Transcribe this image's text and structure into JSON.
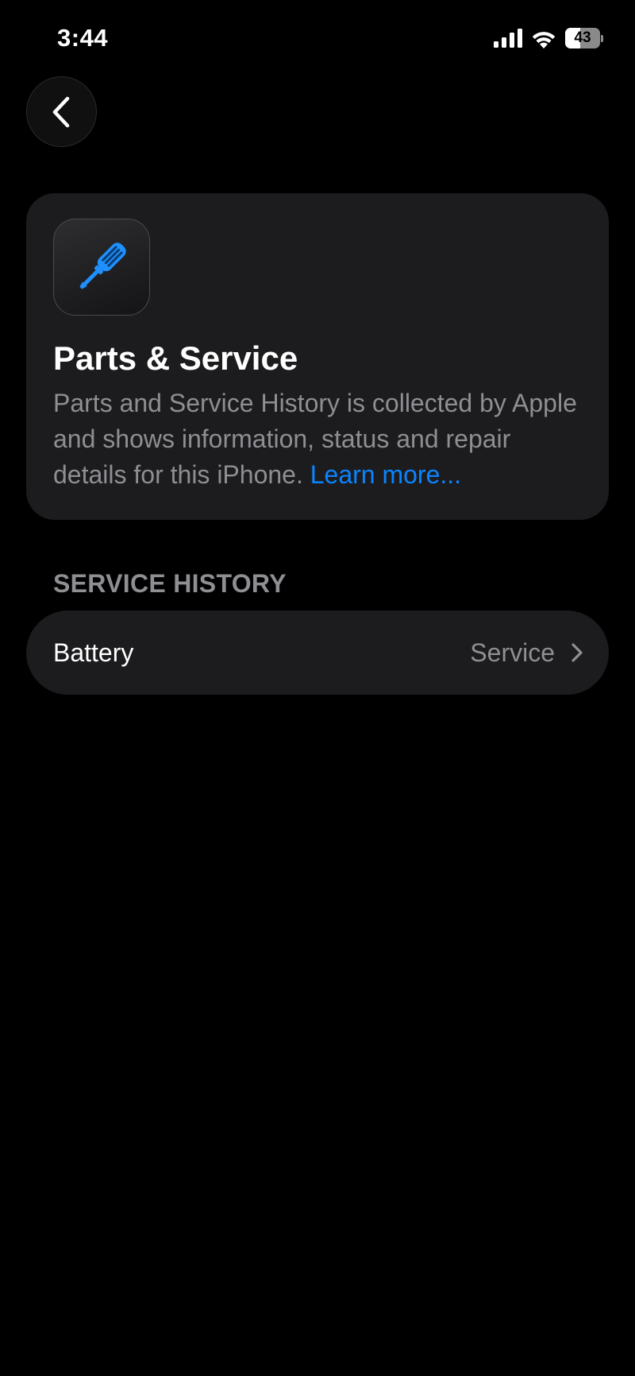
{
  "status_bar": {
    "time": "3:44",
    "battery_level": "43",
    "battery_fraction": 0.43
  },
  "navigation": {
    "back_icon": "chevron-left-icon"
  },
  "header_card": {
    "icon": "screwdriver-icon",
    "icon_color": "#1e90ff",
    "title": "Parts & Service",
    "description": "Parts and Service History is collected by Apple and shows information, status and repair details for this iPhone.",
    "link_label": "Learn more..."
  },
  "service_history": {
    "section_title": "SERVICE HISTORY",
    "items": [
      {
        "label": "Battery",
        "value": "Service",
        "icon": "chevron-right-icon"
      }
    ]
  },
  "colors": {
    "background": "#000000",
    "card": "#1c1c1e",
    "secondary_text": "#8e8e93",
    "link": "#0a84ff"
  }
}
